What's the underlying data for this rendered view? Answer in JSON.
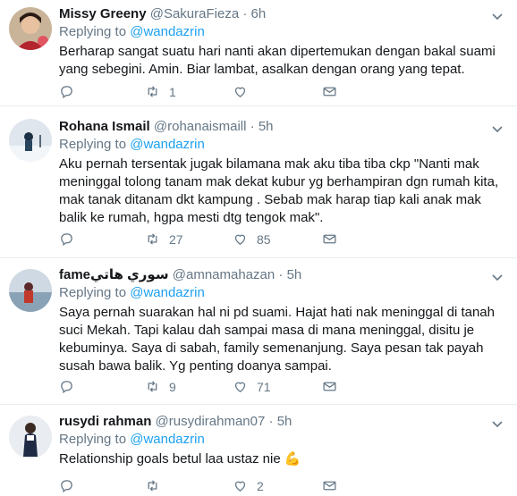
{
  "replying_label": "Replying to",
  "tweets": [
    {
      "name": "Missy Greeny",
      "handle": "@SakuraFieza",
      "dot": "·",
      "time": "6h",
      "reply_to": "@wandazrin",
      "text": "Berharap sangat suatu hari nanti akan dipertemukan dengan bakal suami yang sebegini. Amin.  Biar lambat, asalkan dengan orang yang tepat.",
      "reply_count": "",
      "retweet_count": "1",
      "like_count": ""
    },
    {
      "name": "Rohana Ismail",
      "handle": "@rohanaismaill",
      "dot": "·",
      "time": "5h",
      "reply_to": "@wandazrin",
      "text": "Aku pernah tersentak jugak bilamana mak aku tiba tiba ckp \"Nanti mak meninggal tolong tanam mak dekat kubur yg berhampiran dgn rumah kita, mak tanak ditanam dkt kampung . Sebab mak harap tiap kali anak mak balik ke rumah, hgpa mesti dtg tengok mak\".",
      "reply_count": "",
      "retweet_count": "27",
      "like_count": "85"
    },
    {
      "name": "fameسوري هاتي",
      "handle": "@amnamahazan",
      "dot": "·",
      "time": "5h",
      "reply_to": "@wandazrin",
      "text": "Saya pernah suarakan hal ni pd suami. Hajat hati nak meninggal di tanah suci Mekah. Tapi kalau dah sampai masa di mana meninggal, disitu je kebuminya. Saya di sabah, family semenanjung. Saya pesan tak payah susah bawa balik. Yg penting doanya sampai.",
      "reply_count": "",
      "retweet_count": "9",
      "like_count": "71"
    },
    {
      "name": "rusydi rahman",
      "handle": "@rusydirahman07",
      "dot": "·",
      "time": "5h",
      "reply_to": "@wandazrin",
      "text": "Relationship goals betul laa ustaz nie 💪",
      "reply_count": "",
      "retweet_count": "",
      "like_count": "2"
    }
  ]
}
